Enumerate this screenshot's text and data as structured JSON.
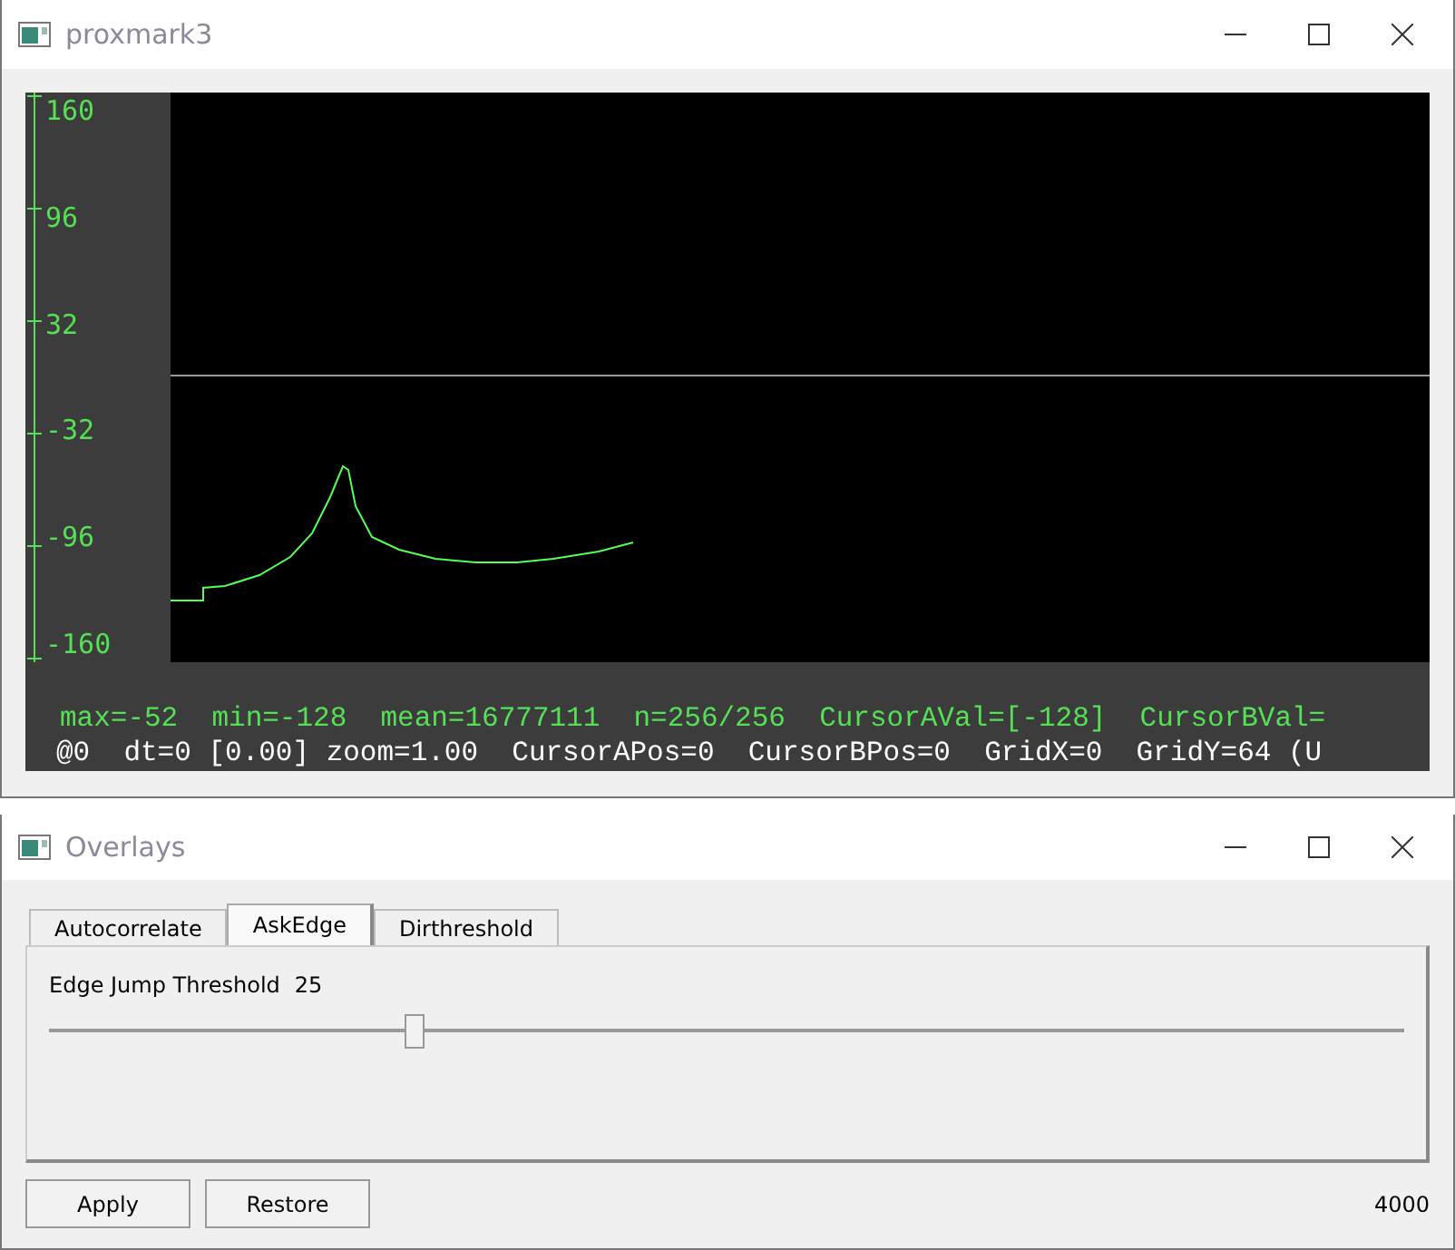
{
  "plot_window": {
    "title": "proxmark3",
    "y_ticks": [
      "160",
      "96",
      "32",
      "-32",
      "-96",
      "-160"
    ],
    "status_lines": [
      {
        "kind": "stats",
        "text": "max=-52  min=-128  mean=16777111  n=256/256  CursorAVal=[-128]  CursorBVal="
      },
      {
        "kind": "info",
        "text": "@0  dt=0 [0.00] zoom=1.00  CursorAPos=0  CursorBPos=0  GridX=0  GridY=64 (U"
      }
    ]
  },
  "overlays_window": {
    "title": "Overlays",
    "tabs": [
      {
        "label": "Autocorrelate",
        "selected": false
      },
      {
        "label": "AskEdge",
        "selected": true
      },
      {
        "label": "Dirthreshold",
        "selected": false
      }
    ],
    "slider": {
      "label": "Edge Jump Threshold",
      "reading": "25",
      "level": 0.27
    },
    "buttons": [
      "Apply",
      "Restore"
    ],
    "status": "4000"
  }
}
